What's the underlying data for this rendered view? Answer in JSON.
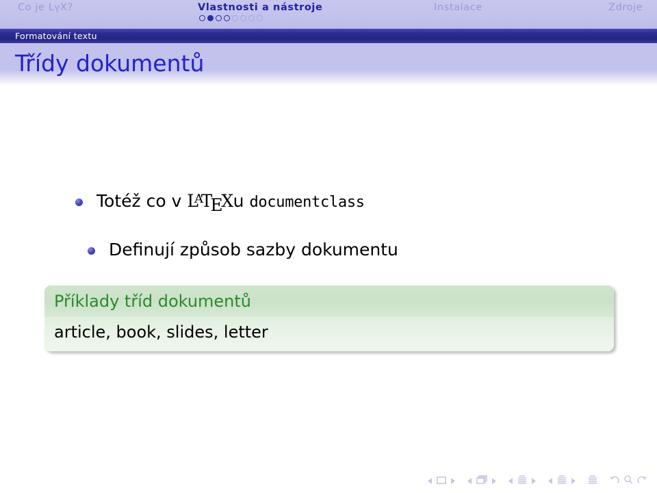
{
  "slide": {
    "language": "cs",
    "colors": {
      "headline_bg": "#c2c2ec",
      "section_bar_bg": "#2d2d94",
      "title_text": "#2222cc",
      "active_tab": "#2222a0",
      "inactive_tab": "#9a9ad6",
      "block_title_text": "#2b8a2b",
      "block_title_bg": "#cbe2c8",
      "block_body_bg": "#e8f3e6",
      "bullet": "#28288e",
      "nav_symbol": "#c6c6e2"
    }
  },
  "nav": {
    "tabs": [
      {
        "id": "co-je-lyx",
        "label": "Co je L",
        "label_sub": "Y",
        "label_tail": "X?",
        "active": false
      },
      {
        "id": "vlastnosti-a-nastroje",
        "label": "Vlastnosti a nástroje",
        "active": true
      },
      {
        "id": "instalace",
        "label": "Instalace",
        "active": false
      },
      {
        "id": "zdroje",
        "label": "Zdroje",
        "active": false
      }
    ],
    "minislides": {
      "total": 8,
      "current_index": 2,
      "states": [
        "visited",
        "current",
        "visited",
        "visited",
        "future",
        "future",
        "future",
        "future"
      ]
    }
  },
  "section": {
    "label": "Formatování textu"
  },
  "frame": {
    "title": "Třídy dokumentů"
  },
  "content": {
    "items": [
      {
        "prefix": "Totéž co v ",
        "latex": {
          "l": "L",
          "a": "A",
          "t": "T",
          "e": "E",
          "x": "X"
        },
        "suffix": "u ",
        "code": "documentclass"
      },
      {
        "text": "Definují způsob sazby dokumentu"
      }
    ]
  },
  "block": {
    "title": "Příklady tříd dokumentů",
    "body": "article, book, slides, letter"
  },
  "navsymbols": {
    "groups": [
      {
        "name": "slide-nav",
        "icon": "slide-icon"
      },
      {
        "name": "frame-nav",
        "icon": "frame-icon"
      },
      {
        "name": "subsection-nav",
        "icon": "subsection-icon"
      },
      {
        "name": "section-nav",
        "icon": "section-icon"
      },
      {
        "name": "presentation",
        "icon": "document-icon"
      }
    ],
    "extras": [
      {
        "name": "back-icon"
      },
      {
        "name": "search-icon"
      },
      {
        "name": "forward-icon"
      }
    ]
  }
}
